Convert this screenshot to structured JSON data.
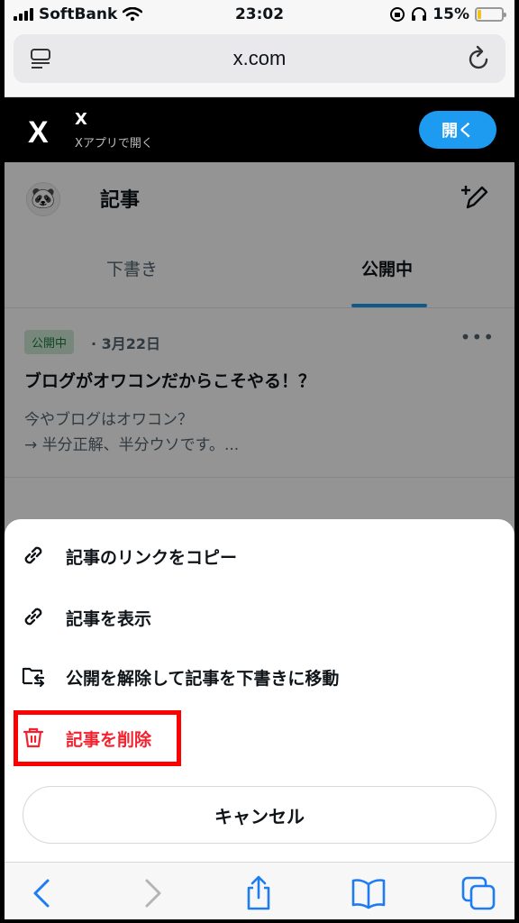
{
  "status_bar": {
    "carrier": "SoftBank",
    "time": "23:02",
    "battery": "15%",
    "battery_level": 0.15
  },
  "browser": {
    "url": "x.com"
  },
  "app_banner": {
    "logo": "X",
    "name": "X",
    "subtitle": "Xアプリで開く",
    "open_button": "開く",
    "accent": "#1d9bf0"
  },
  "page": {
    "title": "記事",
    "tabs": [
      {
        "label": "下書き",
        "active": false
      },
      {
        "label": "公開中",
        "active": true
      }
    ],
    "article": {
      "status": "公開中",
      "date": "· 3月22日",
      "more": "•••",
      "title": "ブログがオワコンだからこそやる！？",
      "excerpt_line1": "今やブログはオワコン？",
      "excerpt_line2": "→ 半分正解、半分ウソです。..."
    }
  },
  "sheet": {
    "items": [
      {
        "label": "記事のリンクをコピー",
        "icon": "link-icon"
      },
      {
        "label": "記事を表示",
        "icon": "link-icon"
      },
      {
        "label": "公開を解除して記事を下書きに移動",
        "icon": "folder-move-icon"
      },
      {
        "label": "記事を削除",
        "icon": "trash-icon",
        "danger": true
      }
    ],
    "cancel": "キャンセル"
  },
  "colors": {
    "danger": "#f4212e",
    "highlight": "#ff0000",
    "badge_bg": "#cfe9d6"
  }
}
